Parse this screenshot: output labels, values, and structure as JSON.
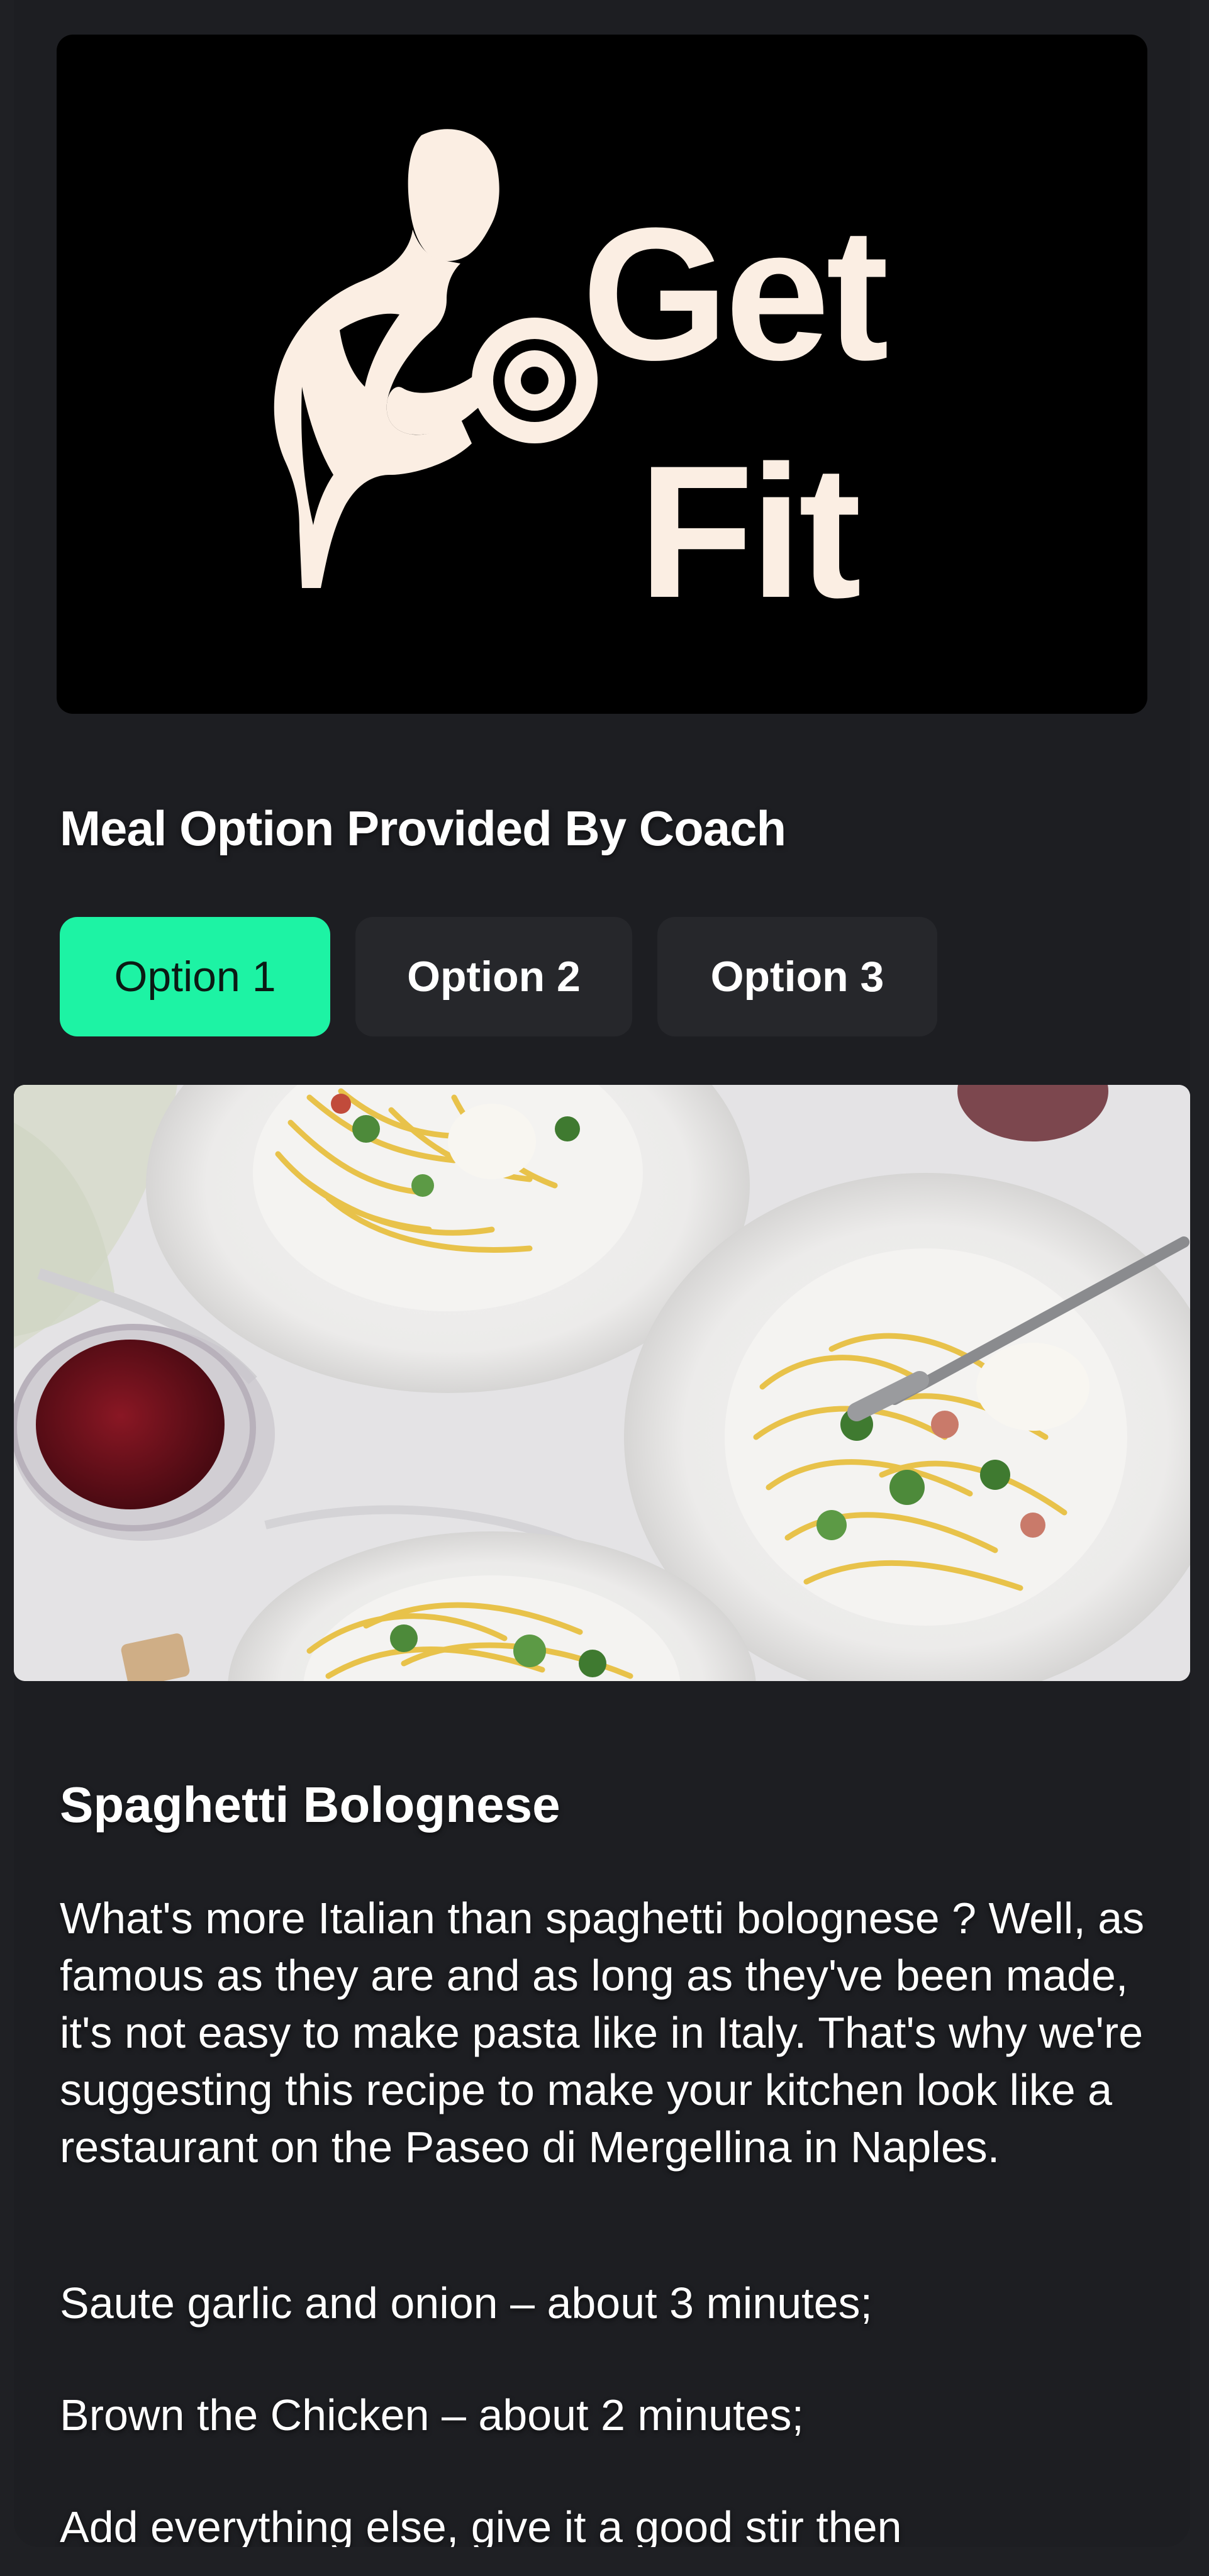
{
  "logo": {
    "line1": "Get",
    "line2": "Fit",
    "icon": "bodybuilder-dumbbell-icon",
    "color": "#fbeee3"
  },
  "section": {
    "title": "Meal Option Provided By Coach"
  },
  "options": {
    "items": [
      {
        "label": "Option 1",
        "selected": true
      },
      {
        "label": "Option 2",
        "selected": false
      },
      {
        "label": "Option 3",
        "selected": false
      }
    ],
    "accent": "#1df3a4"
  },
  "recipe": {
    "title": "Spaghetti Bolognese",
    "description": "What's more Italian than spaghetti bolognese ? Well, as famous as they are and as long as they've been made, it's not easy to make pasta like in Italy. That's why we're suggesting this recipe to make your kitchen look like a restaurant on the Paseo di Mergellina in Naples.",
    "steps": [
      "Saute garlic and onion – about 3 minutes;",
      "Brown the Chicken – about 2 minutes;",
      "Add everything else, give it a good stir then"
    ]
  },
  "colors": {
    "background": "#1d1e22",
    "tab_inactive": "#26272b"
  }
}
